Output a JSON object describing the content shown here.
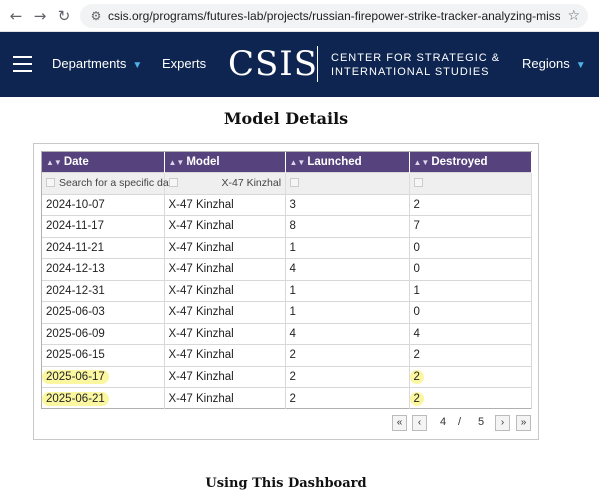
{
  "browser": {
    "back_icon": "arrow-left-icon",
    "forward_icon": "arrow-right-icon",
    "reload_icon": "reload-icon",
    "url": "csis.org/programs/futures-lab/projects/russian-firepower-strike-tracker-analyzing-missile-attack...",
    "bookmark_icon": "star-icon"
  },
  "header": {
    "menu_icon": "hamburger-icon",
    "nav": [
      "Departments",
      "Experts",
      "Regions"
    ],
    "logo": "CSIS",
    "logo_line1": "CENTER FOR STRATEGIC &",
    "logo_line2": "INTERNATIONAL STUDIES",
    "colors": {
      "background": "#0d2550",
      "accent": "#4fb3e8"
    }
  },
  "main": {
    "title": "Model Details",
    "section_title": "Using This Dashboard"
  },
  "table": {
    "columns": [
      "Date",
      "Model",
      "Launched",
      "Destroyed"
    ],
    "filter_placeholder": "Search for a specific dat",
    "filter_model": "X-47 Kinzhal",
    "rows": [
      [
        "2024-10-07",
        "X-47 Kinzhal",
        "3",
        "2"
      ],
      [
        "2024-11-17",
        "X-47 Kinzhal",
        "8",
        "7"
      ],
      [
        "2024-11-21",
        "X-47 Kinzhal",
        "1",
        "0"
      ],
      [
        "2024-12-13",
        "X-47 Kinzhal",
        "4",
        "0"
      ],
      [
        "2024-12-31",
        "X-47 Kinzhal",
        "1",
        "1"
      ],
      [
        "2025-06-03",
        "X-47 Kinzhal",
        "1",
        "0"
      ],
      [
        "2025-06-09",
        "X-47 Kinzhal",
        "4",
        "4"
      ],
      [
        "2025-06-15",
        "X-47 Kinzhal",
        "2",
        "2"
      ],
      [
        "2025-06-17",
        "X-47 Kinzhal",
        "2",
        "2"
      ],
      [
        "2025-06-21",
        "X-47 Kinzhal",
        "2",
        "2"
      ]
    ],
    "highlighted_rows": [
      8,
      9
    ],
    "header_color": "#56437d",
    "highlight_color": "#fbf7a0"
  },
  "pager": {
    "first": "«",
    "prev": "‹",
    "page": "4",
    "separator": "/",
    "total": "5",
    "next": "›",
    "last": "»"
  }
}
